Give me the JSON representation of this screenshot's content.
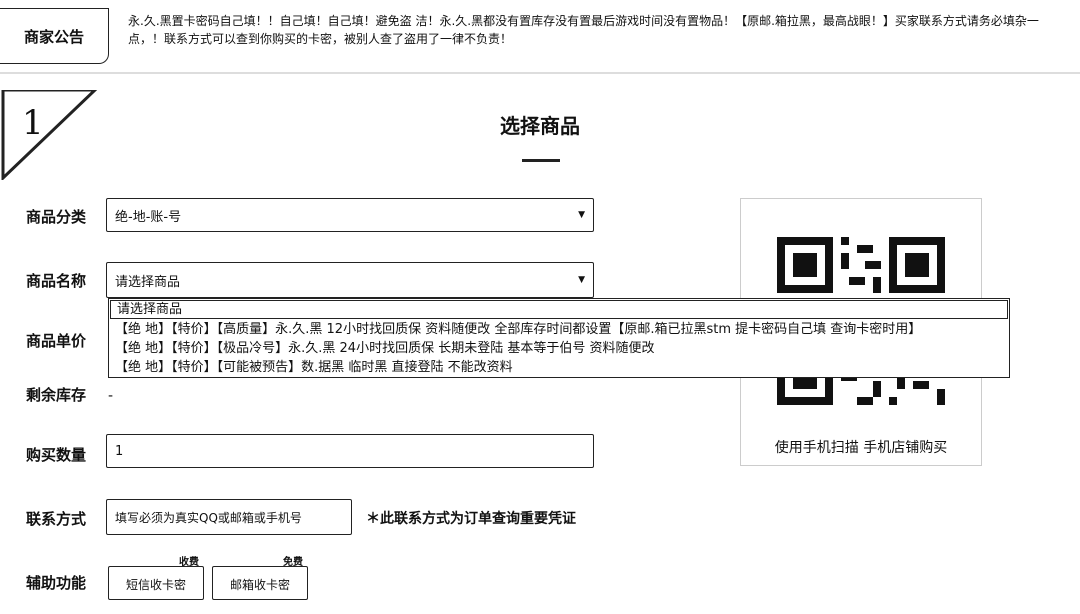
{
  "notice": {
    "label": "商家公告",
    "text": "永.久.黑置卡密码自己填！！自己填！自己填！避免盗 洁！永.久.黑都没有置库存没有置最后游戏时间没有置物品！【原邮.箱拉黑，最高战眼！】买家联系方式请务必填杂一点，！联系方式可以查到你购买的卡密，被别人查了盗用了一律不负责！"
  },
  "step": {
    "number": "1",
    "title": "选择商品"
  },
  "form": {
    "category": {
      "label": "商品分类",
      "value": "绝-地-账-号"
    },
    "product": {
      "label": "商品名称",
      "value": "请选择商品",
      "options": [
        "请选择商品",
        "【绝 地】【特价】【高质量】永.久.黑 12小时找回质保 资料随便改 全部库存时间都设置【原邮.箱已拉黑stm 提卡密码自己填 查询卡密时用】",
        "【绝 地】【特价】【极品冷号】永.久.黑 24小时找回质保 长期未登陆 基本等于伯号 资料随便改",
        "【绝 地】【特价】【可能被预告】数.据黑 临时黑 直接登陆 不能改资料"
      ]
    },
    "price": {
      "label": "商品单价"
    },
    "stock": {
      "label": "剩余库存",
      "value": "-"
    },
    "quantity": {
      "label": "购买数量",
      "value": "1"
    },
    "contact": {
      "label": "联系方式",
      "placeholder": "填写必须为真实QQ或邮箱或手机号",
      "hint": "＊此联系方式为订单查询重要凭证"
    },
    "aux": {
      "label": "辅助功能",
      "sms": {
        "label": "短信收卡密",
        "tag": "收费"
      },
      "email": {
        "label": "邮箱收卡密",
        "tag": "免费"
      }
    }
  },
  "qr": {
    "caption": "使用手机扫描  手机店铺购买"
  }
}
